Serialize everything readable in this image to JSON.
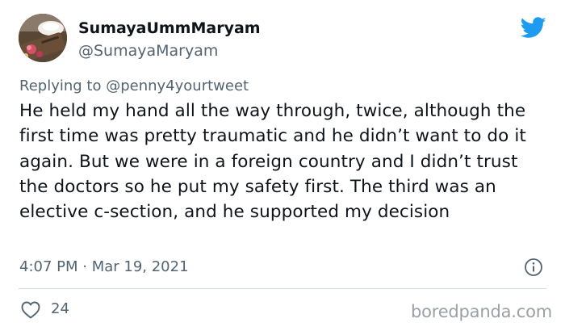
{
  "author": {
    "display_name": "SumayaUmmMaryam",
    "handle": "@SumayaMaryam"
  },
  "reply": {
    "prefix": "Replying to ",
    "mention": "@penny4yourtweet"
  },
  "tweet": {
    "text": "He held my hand all the way through, twice, although the first time was pretty traumatic and he didn’t want to do it again. But we were in a foreign country and I didn’t trust the doctors so he put my safety first. The third was an elective c-section, and he supported my decision",
    "timestamp": "4:07 PM · Mar 19, 2021"
  },
  "actions": {
    "like_count": "24"
  },
  "watermark": "boredpanda.com",
  "colors": {
    "twitter_blue": "#1d9bf0",
    "secondary_text": "#536471",
    "divider": "#cfd9de"
  },
  "icons": {
    "brand": "twitter-bird-icon",
    "info": "info-icon",
    "like": "heart-icon"
  }
}
